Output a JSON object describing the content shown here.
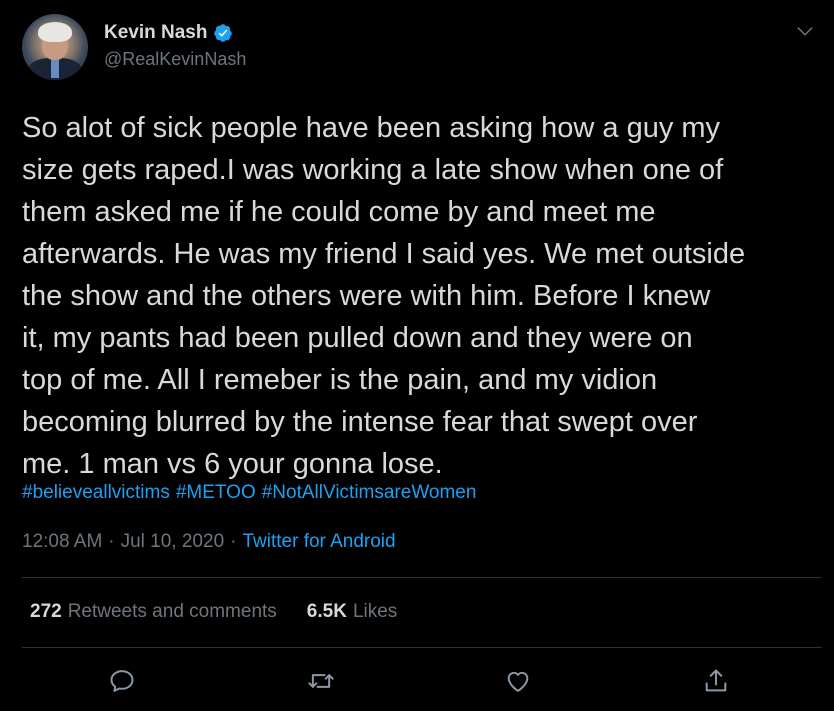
{
  "author": {
    "display_name": "Kevin Nash",
    "handle": "@RealKevinNash",
    "verified": true
  },
  "tweet": {
    "text": "So alot of sick people have been asking how a guy my\nsize gets raped.I was working a late show when one of\nthem asked me if he could come by and meet me\nafterwards. He was my friend I said yes. We met outside\nthe show and the others were with him. Before I knew\nit, my pants had been pulled down and they were on\ntop of me. All I remeber is the pain, and my vidion\nbecoming blurred by the intense fear that swept over\nme. 1 man vs 6 your gonna lose.",
    "hashtags": [
      "#believeallvictims",
      "#METOO",
      "#NotAllVictimsareWomen"
    ]
  },
  "meta": {
    "time": "12:08 AM",
    "separator": "·",
    "date": "Jul 10, 2020",
    "source": "Twitter for Android"
  },
  "stats": {
    "retweets_count": "272",
    "retweets_label": "Retweets and comments",
    "likes_count": "6.5K",
    "likes_label": "Likes"
  },
  "actions": [
    {
      "name": "reply",
      "icon": "reply-icon"
    },
    {
      "name": "retweet",
      "icon": "retweet-icon"
    },
    {
      "name": "like",
      "icon": "heart-icon"
    },
    {
      "name": "share",
      "icon": "share-icon"
    }
  ],
  "colors": {
    "background": "#000000",
    "text": "#d9d9d9",
    "secondary": "#6e767d",
    "accent": "#1da1f2",
    "divider": "#2f3336"
  }
}
